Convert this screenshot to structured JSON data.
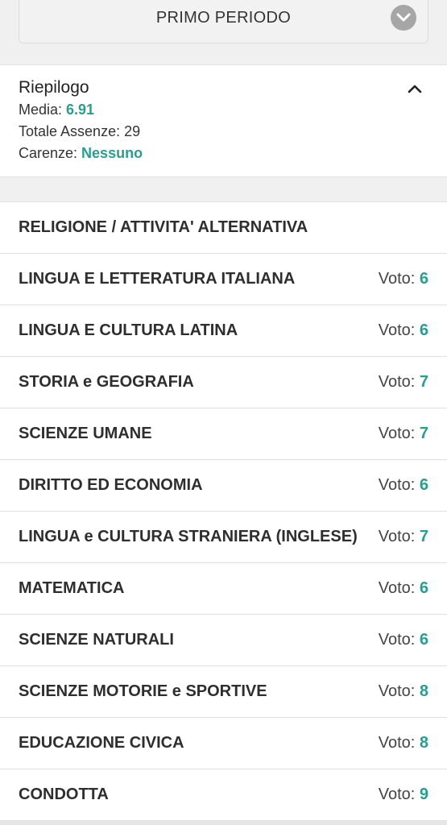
{
  "period_select": {
    "label": "PRIMO PERIODO"
  },
  "summary": {
    "title": "Riepilogo",
    "media_label": "Media: ",
    "media_value": "6.91",
    "assenze_text": "Totale Assenze: 29",
    "carenze_label": "Carenze: ",
    "carenze_value": "Nessuno"
  },
  "grade_label": "Voto: ",
  "subjects": [
    {
      "name": "RELIGIONE / ATTIVITA' ALTERNATIVA",
      "grade": ""
    },
    {
      "name": "LINGUA E LETTERATURA ITALIANA",
      "grade": "6"
    },
    {
      "name": "LINGUA E CULTURA LATINA",
      "grade": "6"
    },
    {
      "name": "STORIA e GEOGRAFIA",
      "grade": "7"
    },
    {
      "name": "SCIENZE UMANE",
      "grade": "7"
    },
    {
      "name": "DIRITTO ED ECONOMIA",
      "grade": "6"
    },
    {
      "name": "LINGUA e CULTURA STRANIERA (INGLESE)",
      "grade": "7"
    },
    {
      "name": "MATEMATICA",
      "grade": "6"
    },
    {
      "name": "SCIENZE NATURALI",
      "grade": "6"
    },
    {
      "name": "SCIENZE MOTORIE e SPORTIVE",
      "grade": "8"
    },
    {
      "name": "EDUCAZIONE CIVICA",
      "grade": "8"
    },
    {
      "name": "CONDOTTA",
      "grade": "9"
    }
  ],
  "colors": {
    "accent": "#2a9d8f",
    "chevron_bg": "#a6a6a6"
  },
  "icons": {
    "period_dropdown": "chevron-down-icon",
    "summary_toggle": "chevron-up-icon"
  }
}
